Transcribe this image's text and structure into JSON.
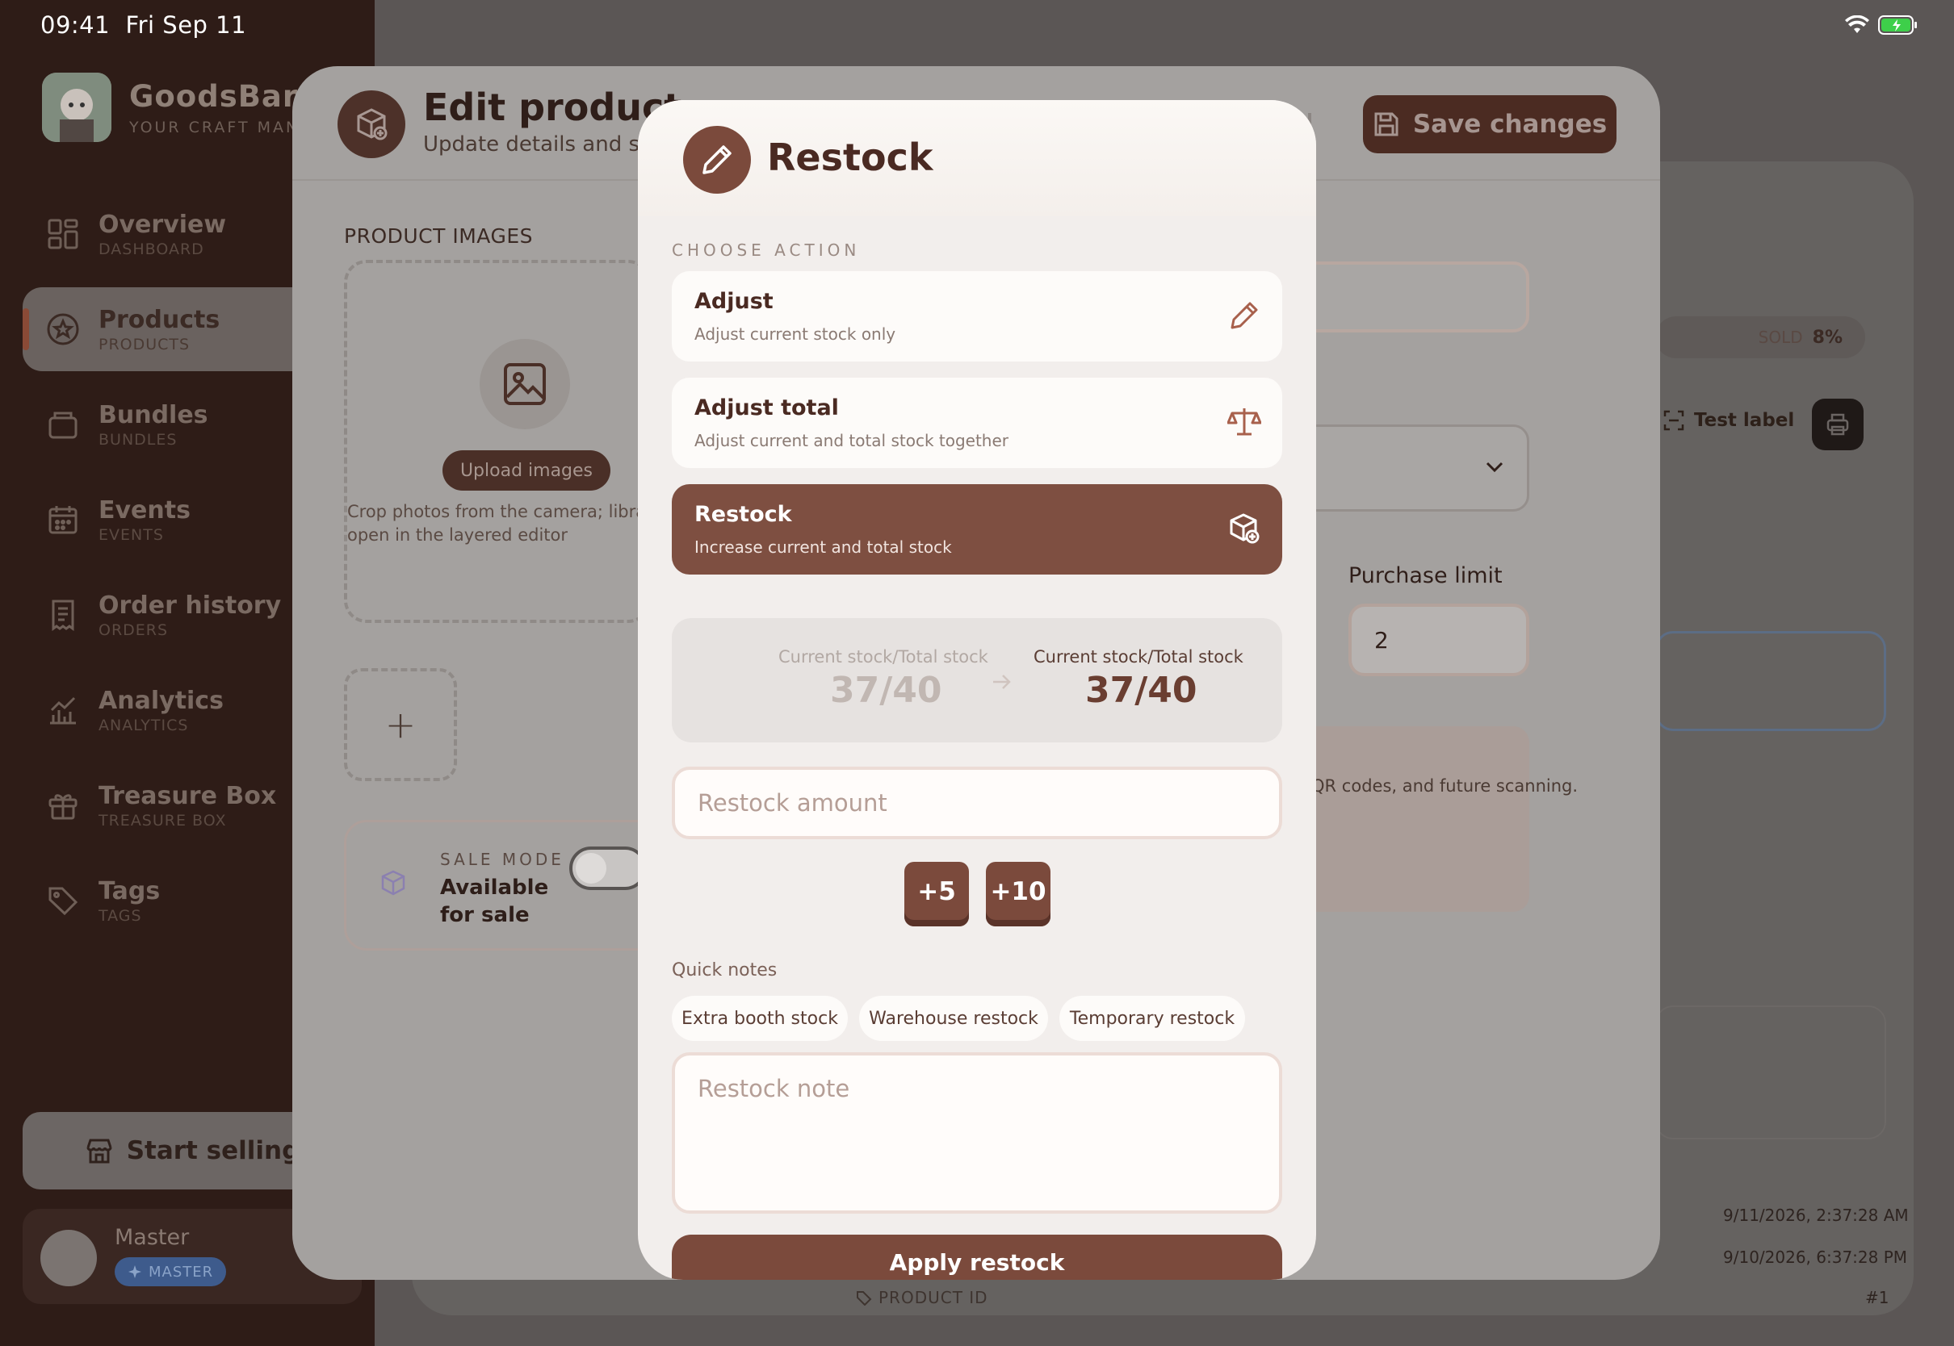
{
  "status_bar": {
    "time": "09:41",
    "date": "Fri Sep 11"
  },
  "sidebar": {
    "brand_name": "GoodsBar",
    "brand_sub": "YOUR CRAFT MANA",
    "items": [
      {
        "label": "Overview",
        "sub": "DASHBOARD",
        "icon": "grid-icon"
      },
      {
        "label": "Products",
        "sub": "PRODUCTS",
        "icon": "star-circle-icon",
        "active": true
      },
      {
        "label": "Bundles",
        "sub": "BUNDLES",
        "icon": "box-icon"
      },
      {
        "label": "Events",
        "sub": "EVENTS",
        "icon": "calendar-icon"
      },
      {
        "label": "Order history",
        "sub": "ORDERS",
        "icon": "receipt-icon"
      },
      {
        "label": "Analytics",
        "sub": "ANALYTICS",
        "icon": "chart-icon"
      },
      {
        "label": "Treasure Box",
        "sub": "TREASURE BOX",
        "icon": "gift-icon"
      },
      {
        "label": "Tags",
        "sub": "TAGS",
        "icon": "tag-icon"
      }
    ],
    "start_selling": "Start selling",
    "user": {
      "name": "Master",
      "badge": "MASTER"
    }
  },
  "background": {
    "sold_label": "SOLD",
    "sold_value": "8%",
    "test_label": "Test label",
    "timestamp_1": "9/11/2026, 2:37:28 AM",
    "timestamp_2": "9/10/2026, 6:37:28 PM",
    "product_id_label": "PRODUCT ID",
    "row_number": "#1"
  },
  "edit_modal": {
    "title": "Edit product",
    "subtitle": "Update details and sto",
    "save_label": "Save changes",
    "images_label": "PRODUCT IMAGES",
    "upload_label": "Upload images",
    "upload_hint": "Crop photos from the camera; library open in the layered editor",
    "add_symbol": "+",
    "sale_mode_label": "SALE MODE",
    "sale_status": "Available for sale",
    "purchase_limit_label": "Purchase limit",
    "purchase_limit_value": "2",
    "info_text": "QR codes, and future scanning."
  },
  "restock_modal": {
    "title": "Restock",
    "choose_action": "CHOOSE ACTION",
    "actions": [
      {
        "title": "Adjust",
        "desc": "Adjust current stock only",
        "icon": "pencil-icon",
        "selected": false
      },
      {
        "title": "Adjust total",
        "desc": "Adjust current and total stock together",
        "icon": "scale-icon",
        "selected": false
      },
      {
        "title": "Restock",
        "desc": "Increase current and total stock",
        "icon": "box-plus-icon",
        "selected": true
      }
    ],
    "stock_before_label": "Current stock/Total stock",
    "stock_before_value": "37/40",
    "stock_after_label": "Current stock/Total stock",
    "stock_after_value": "37/40",
    "amount_placeholder": "Restock amount",
    "quick_buttons": [
      "+5",
      "+10"
    ],
    "quick_notes_label": "Quick notes",
    "quick_notes": [
      "Extra booth stock",
      "Warehouse restock",
      "Temporary restock"
    ],
    "note_placeholder": "Restock note",
    "apply_label": "Apply restock"
  },
  "colors": {
    "accent": "#7b4a3c",
    "sidebar_bg": "#2e1c17",
    "modal_bg": "#f2eeec"
  }
}
